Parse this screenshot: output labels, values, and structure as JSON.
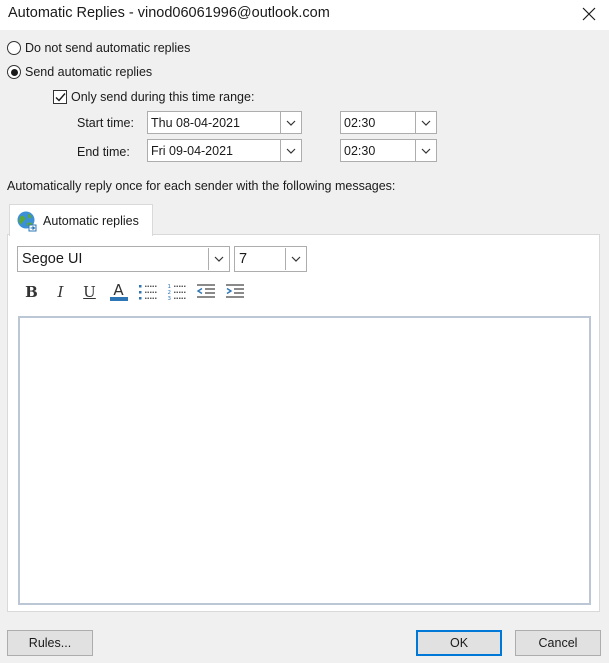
{
  "window": {
    "title": "Automatic Replies - vinod06061996@outlook.com"
  },
  "options": {
    "no_reply_label": "Do not send automatic replies",
    "send_reply_label": "Send automatic replies",
    "selected": "send_reply",
    "time_range_label": "Only send during this time range:",
    "time_range_checked": true
  },
  "schedule": {
    "start_label": "Start time:",
    "start_date": "Thu 08-04-2021",
    "start_time": "02:30",
    "end_label": "End time:",
    "end_date": "Fri 09-04-2021",
    "end_time": "02:30"
  },
  "message": {
    "instruction": "Automatically reply once for each sender with the following messages:",
    "tab_label": "Automatic replies",
    "font_name": "Segoe UI",
    "font_size": "7",
    "body": ""
  },
  "toolbar": {
    "bold": "B",
    "italic": "I",
    "underline": "U",
    "font_color": "A"
  },
  "footer": {
    "rules_label": "Rules...",
    "ok_label": "OK",
    "cancel_label": "Cancel"
  },
  "icons": [
    "close-icon",
    "chevron-down-icon",
    "check-icon",
    "globe-icon",
    "bullets-icon",
    "numbering-icon",
    "decrease-indent-icon",
    "increase-indent-icon"
  ],
  "colors": {
    "accent": "#0078d7",
    "font_color_bar": "#2e75b6",
    "dialog_bg": "#f0f0f0"
  }
}
